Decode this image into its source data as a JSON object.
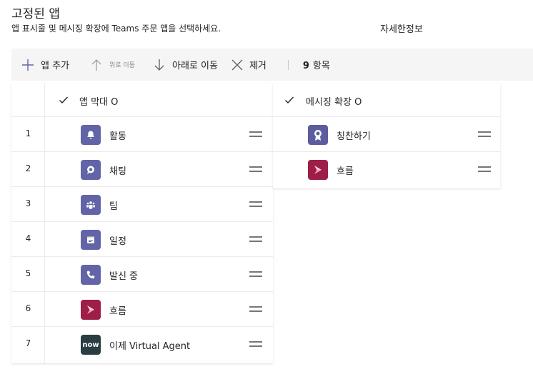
{
  "header": {
    "title": "고정된 앱",
    "subtitle": "앱 표시줄 및 메시징 확장에 Teams 주문 앱을 선택하세요.",
    "learn_more": "자세한정보"
  },
  "toolbar": {
    "add_label": "앱 추가",
    "move_up_label": "위로 이동",
    "move_down_label": "아래로 이동",
    "remove_label": "제거",
    "count_number": "9",
    "count_label": "항목"
  },
  "app_bar": {
    "header": "앱 막대 O",
    "rows": [
      {
        "num": "1",
        "name": "활동",
        "icon": "bell-icon"
      },
      {
        "num": "2",
        "name": "채팅",
        "icon": "chat-icon"
      },
      {
        "num": "3",
        "name": "팀",
        "icon": "teams-icon"
      },
      {
        "num": "4",
        "name": "일정",
        "icon": "calendar-icon"
      },
      {
        "num": "5",
        "name": "발신 중",
        "icon": "phone-icon"
      },
      {
        "num": "6",
        "name": "흐름",
        "icon": "flow-icon"
      },
      {
        "num": "7",
        "name": "이제 Virtual Agent",
        "icon": "now-logo",
        "logo_text": "now"
      }
    ]
  },
  "messaging_ext": {
    "header": "메시징 확장 O",
    "rows": [
      {
        "name": "칭찬하기",
        "icon": "praise-badge-icon"
      },
      {
        "name": "흐름",
        "icon": "flow-icon"
      }
    ]
  },
  "colors": {
    "purple": "#6264a7",
    "flow": "#9d1e47",
    "now": "#293e40",
    "toolbar_bg": "#f5f5f5"
  }
}
